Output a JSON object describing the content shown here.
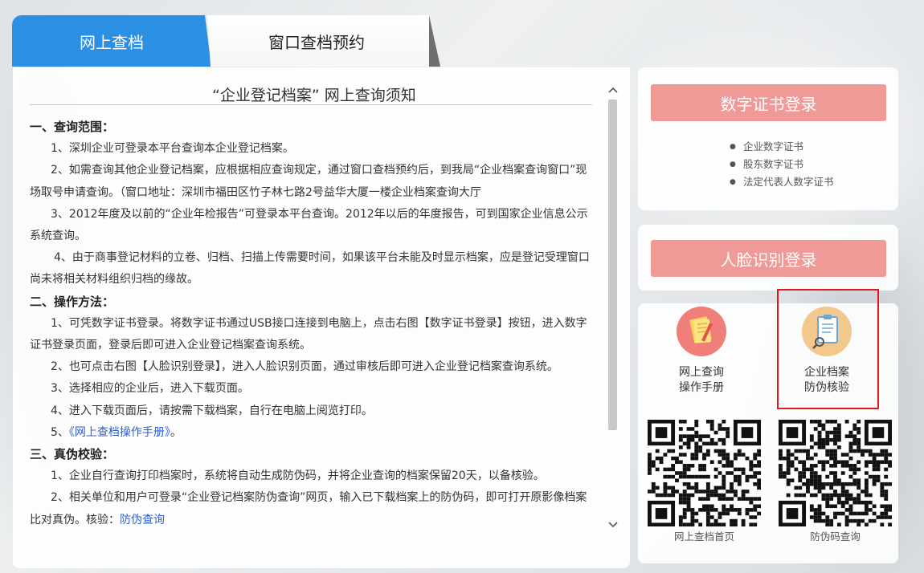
{
  "tabs": {
    "online": "网上查档",
    "window": "窗口查档预约"
  },
  "notice": {
    "title": "“企业登记档案” 网上查询须知",
    "s1_head": "一、查询范围：",
    "s1_p1": "1、深圳企业可登录本平台查询本企业登记档案。",
    "s1_p2": "2、如需查询其他企业登记档案，应根据相应查询规定，通过窗口查档预约后，到我局“企业档案查询窗口”现场取号申请查询。（窗口地址：深圳市福田区竹子林七路2号益华大厦一楼企业档案查询大厅",
    "s1_p3": "3、2012年度及以前的“企业年检报告”可登录本平台查询。2012年以后的年度报告，可到国家企业信息公示系统查询。",
    "s1_p4": "4、由于商事登记材料的立卷、归档、扫描上传需要时间，如果该平台未能及时显示档案，应是登记受理窗口尚未将相关材料组织归档的缘故。",
    "s2_head": "二、操作方法：",
    "s2_p1": "1、可凭数字证书登录。将数字证书通过USB接口连接到电脑上，点击右图【数字证书登录】按钮，进入数字证书登录页面，登录后即可进入企业登记档案查询系统。",
    "s2_p2": "2、也可点击右图【人脸识别登录】，进入人脸识别页面，通过审核后即可进入企业登记档案查询系统。",
    "s2_p3": "3、选择相应的企业后，进入下载页面。",
    "s2_p4": "4、进入下载页面后，请按需下载档案，自行在电脑上阅览打印。",
    "s2_p5_prefix": "5、",
    "s2_p5_link": "《网上查档操作手册》",
    "s2_p5_suffix": "。",
    "s3_head": "三、真伪校验：",
    "s3_p1": "1、企业自行查询打印档案时，系统将自动生成防伪码，并将企业查询的档案保留20天，以备核验。",
    "s3_p2_text": "2、相关单位和用户可登录“企业登记档案防伪查询”网页，输入已下载档案上的防伪码，即可打开原影像档案比对真伪。核验：",
    "s3_p2_link": "防伪查询"
  },
  "right": {
    "cert_login": "数字证书登录",
    "cert_types": [
      "企业数字证书",
      "股东数字证书",
      "法定代表人数字证书"
    ],
    "face_login": "人脸识别登录",
    "manual_line1": "网上查询",
    "manual_line2": "操作手册",
    "verify_line1": "企业档案",
    "verify_line2": "防伪核验",
    "qr1_label": "网上查档首页",
    "qr2_label": "防伪码查询"
  },
  "colors": {
    "tab_active": "#2b8fe3",
    "login_button": "#f09a98",
    "link": "#2d5fcf",
    "highlight": "#e3161c"
  }
}
